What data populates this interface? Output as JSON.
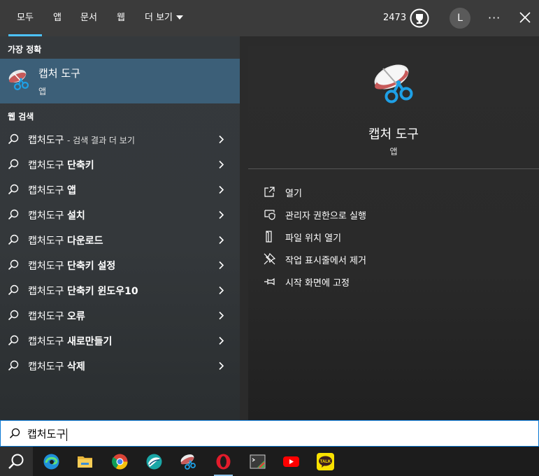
{
  "tabs": [
    {
      "label": "모두",
      "active": true
    },
    {
      "label": "앱"
    },
    {
      "label": "문서"
    },
    {
      "label": "웹"
    },
    {
      "label": "더 보기"
    }
  ],
  "header": {
    "points": "2473",
    "avatar_initial": "L",
    "more": "···"
  },
  "best_match": {
    "section_title": "가장 정확",
    "name": "캡처 도구",
    "type": "앱"
  },
  "web_search": {
    "section_title": "웹 검색",
    "items": [
      {
        "query": "캡처도구",
        "suffix": "- 검색 결과 더 보기"
      },
      {
        "query": "캡처도구",
        "suffix": "단축키"
      },
      {
        "query": "캡처도구",
        "suffix": "앱"
      },
      {
        "query": "캡처도구",
        "suffix": "설치"
      },
      {
        "query": "캡처도구",
        "suffix": "다운로드"
      },
      {
        "query": "캡처도구",
        "suffix": "단축키 설정"
      },
      {
        "query": "캡처도구",
        "suffix": "단축키 윈도우10"
      },
      {
        "query": "캡처도구",
        "suffix": "오류"
      },
      {
        "query": "캡처도구",
        "suffix": "새로만들기"
      },
      {
        "query": "캡처도구",
        "suffix": "삭제"
      }
    ]
  },
  "detail": {
    "name": "캡처 도구",
    "type": "앱",
    "actions": [
      {
        "label": "열기",
        "icon": "open-icon"
      },
      {
        "label": "관리자 권한으로 실행",
        "icon": "shield-icon"
      },
      {
        "label": "파일 위치 열기",
        "icon": "file-location-icon"
      },
      {
        "label": "작업 표시줄에서 제거",
        "icon": "unpin-icon"
      },
      {
        "label": "시작 화면에 고정",
        "icon": "pin-icon"
      }
    ]
  },
  "search": {
    "value": "캡처도구"
  },
  "colors": {
    "accent": "#4cc2ff",
    "selected": "#3c5f78",
    "search_border": "#0a78d4"
  }
}
